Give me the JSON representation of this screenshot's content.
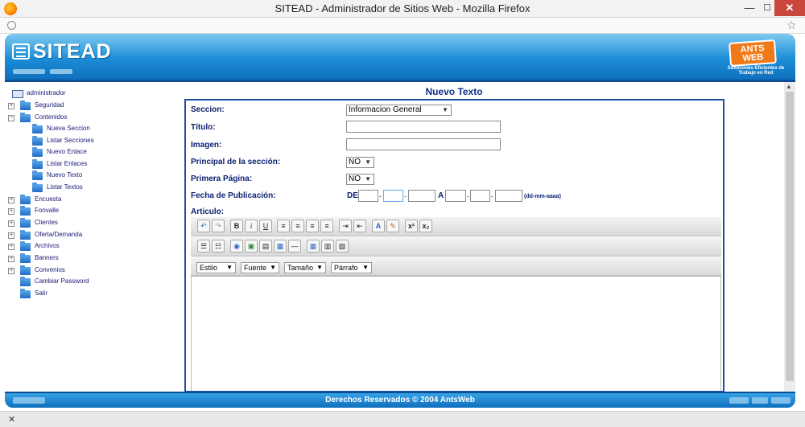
{
  "window": {
    "title": "SITEAD - Administrador de Sitios Web - Mozilla Firefox",
    "minimize": "—",
    "maximize": "☐",
    "close": "✕"
  },
  "urlbar": {
    "url_text": ""
  },
  "header": {
    "logo_text": "SITEAD",
    "brand_text": "ANTS WEB",
    "brand_tagline": "Soluciones Eficientes de Trabajo en Red"
  },
  "tree": {
    "root": "administrador",
    "items": [
      "Seguridad",
      "Contenidos",
      "Nueva Seccion",
      "Listar Secciones",
      "Nuevo Enlace",
      "Listar Enlaces",
      "Nuevo Texto",
      "Listar Textos",
      "Encuesta",
      "Fonvalle",
      "Clientes",
      "Oferta/Demanda",
      "Archivos",
      "Banners",
      "Convenios",
      "Cambiar Password",
      "Salir"
    ]
  },
  "form": {
    "title": "Nuevo Texto",
    "seccion_label": "Seccion:",
    "seccion_value": "Informacion General",
    "titulo_label": "Título:",
    "imagen_label": "Imagen:",
    "principal_label": "Principal de la sección:",
    "principal_value": "NO",
    "primera_label": "Primera Página:",
    "primera_value": "NO",
    "fecha_label": "Fecha de Publicación:",
    "de_label": "DE",
    "a_label": "A",
    "date_sep": "-",
    "date_hint": "(dd-mm-aaaa)",
    "articulo_label": "Articulo:"
  },
  "editor": {
    "undo": "↶",
    "redo": "↷",
    "bold": "B",
    "italic": "i",
    "underline": "U",
    "superscript": "x²",
    "subscript": "x₂",
    "text_color": "A",
    "styles": [
      "Estilo",
      "Fuente",
      "Tamaño",
      "Párrafo"
    ]
  },
  "footer": {
    "text": "Derechos Reservados © 2004 AntsWeb"
  },
  "status": {
    "close": "✕"
  }
}
